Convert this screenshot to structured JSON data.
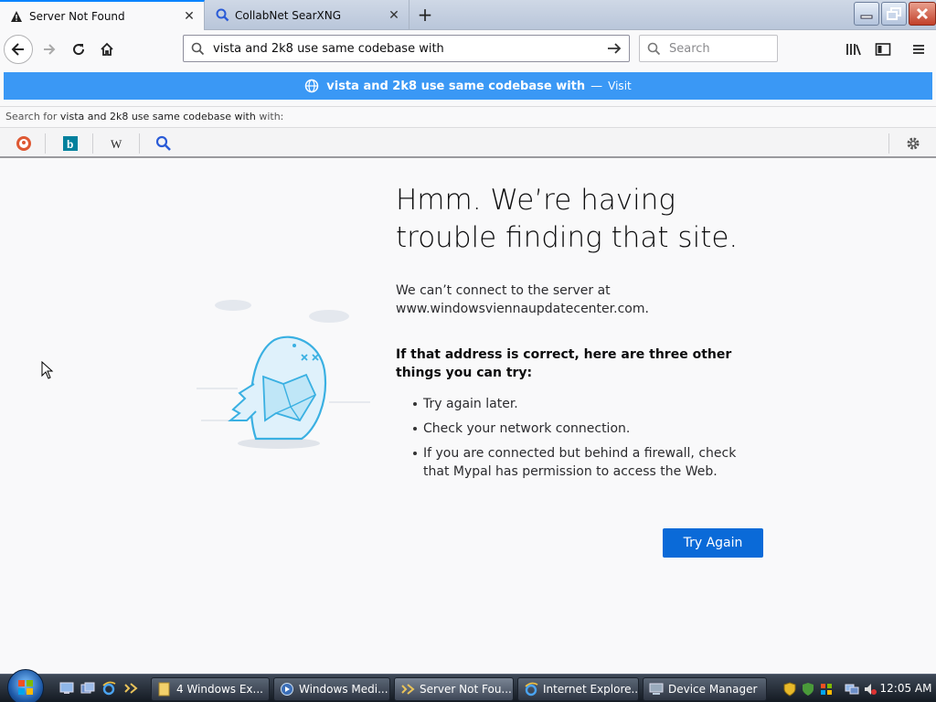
{
  "tabs": [
    {
      "label": "Server Not Found",
      "icon": "warning-icon",
      "active": true
    },
    {
      "label": "CollabNet SearXNG",
      "icon": "search-icon",
      "active": false
    }
  ],
  "navbar": {
    "url_value": "vista and 2k8 use same codebase with",
    "search_placeholder": "Search"
  },
  "popup": {
    "query": "vista and 2k8 use same codebase with",
    "dash": "—",
    "visit": "Visit"
  },
  "search_for": {
    "prefix": "Search for",
    "query": "vista and 2k8 use same codebase with",
    "suffix": "with:"
  },
  "engines": [
    "duckduckgo-icon",
    "bing-icon",
    "wikipedia-icon",
    "searxng-icon"
  ],
  "error": {
    "title": "Hmm. We’re having trouble finding that site.",
    "desc_line1": "We can’t connect to the server at",
    "desc_address": "www.windowsviennaupdatecenter.com.",
    "subtitle": "If that address is correct, here are three other things you can try:",
    "items": [
      "Try again later.",
      "Check your network connection.",
      "If you are connected but behind a firewall, check that Mypal has permission to access the Web."
    ],
    "button": "Try Again"
  },
  "taskbar": {
    "tasks": [
      {
        "label": "4 Windows Ex...",
        "icon": "folder-icon"
      },
      {
        "label": "Windows Medi...",
        "icon": "media-player-icon"
      },
      {
        "label": "Server Not Fou...",
        "icon": "mypal-icon"
      },
      {
        "label": "Internet Explore...",
        "icon": "ie-icon"
      },
      {
        "label": "Device Manager",
        "icon": "device-manager-icon"
      }
    ],
    "clock": "12:05 AM"
  },
  "colors": {
    "accent": "#0a84ff",
    "popup_bg": "#3a98f5",
    "button": "#0a6ad8"
  }
}
